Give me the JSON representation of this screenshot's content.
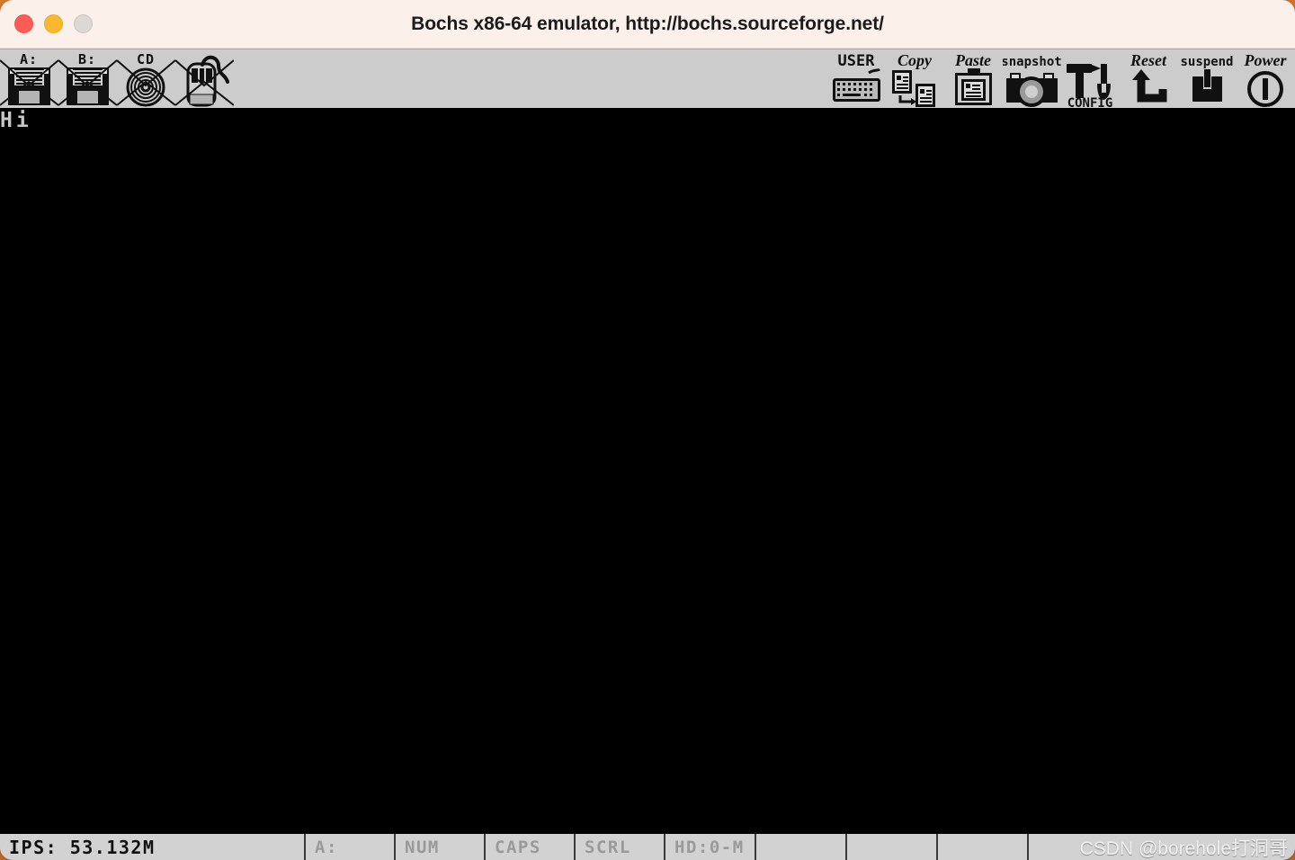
{
  "window": {
    "title": "Bochs x86-64 emulator, http://bochs.sourceforge.net/",
    "traffic_lights": [
      {
        "name": "close",
        "color": "#fa5d55"
      },
      {
        "name": "minimize",
        "color": "#f9b82e"
      },
      {
        "name": "zoom",
        "color": "#ddd8d3"
      }
    ]
  },
  "toolbar": {
    "background": "#cccccc",
    "left_buttons": [
      {
        "icon": "floppy-a-icon",
        "label": "A:",
        "disabled": true
      },
      {
        "icon": "floppy-b-icon",
        "label": "B:",
        "disabled": true
      },
      {
        "icon": "cdrom-icon",
        "label": "CD",
        "disabled": true
      },
      {
        "icon": "mouse-icon",
        "label": "",
        "disabled": true
      }
    ],
    "right_buttons": [
      {
        "icon": "keyboard-icon",
        "label": "USER",
        "disabled": false
      },
      {
        "icon": "copy-icon",
        "label": "Copy",
        "disabled": false
      },
      {
        "icon": "paste-icon",
        "label": "Paste",
        "disabled": false
      },
      {
        "icon": "camera-icon",
        "label": "snapshot",
        "disabled": false
      },
      {
        "icon": "tools-icon",
        "label": "CONFIG",
        "disabled": false
      },
      {
        "icon": "reset-icon",
        "label": "Reset",
        "disabled": false
      },
      {
        "icon": "suspend-icon",
        "label": "suspend",
        "disabled": false
      },
      {
        "icon": "power-icon",
        "label": "Power",
        "disabled": false
      }
    ]
  },
  "screen": {
    "background": "#000000",
    "foreground": "#c8c8c8",
    "lines": [
      "Hi"
    ]
  },
  "statusbar": {
    "background": "#d2d2d2",
    "active_color": "#101010",
    "inactive_color": "#9a9a9a",
    "cells": [
      {
        "name": "ips",
        "text": "IPS: 53.132M",
        "active": true
      },
      {
        "name": "floppy",
        "text": "A:",
        "active": false
      },
      {
        "name": "num",
        "text": "NUM",
        "active": false
      },
      {
        "name": "caps",
        "text": "CAPS",
        "active": false
      },
      {
        "name": "scrl",
        "text": "SCRL",
        "active": false
      },
      {
        "name": "hd",
        "text": "HD:0-M",
        "active": false
      },
      {
        "name": "spare1",
        "text": "",
        "active": false
      },
      {
        "name": "spare2",
        "text": "",
        "active": false
      },
      {
        "name": "spare3",
        "text": "",
        "active": false
      },
      {
        "name": "spare4",
        "text": "",
        "active": false
      }
    ],
    "watermark": "CSDN @borehole打洞哥"
  }
}
